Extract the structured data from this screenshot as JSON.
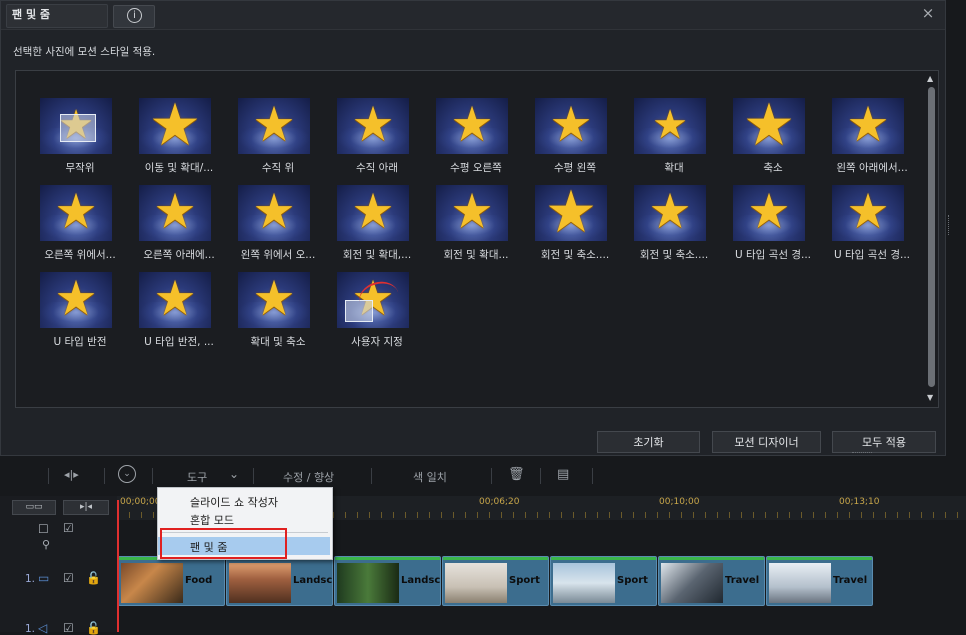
{
  "dialog": {
    "title": "팬 및 줌",
    "close_glyph": "×",
    "info_glyph": "i",
    "instruction": "선택한 사진에 모션 스타일 적용.",
    "styles": [
      "무작위",
      "이동 및 확대/...",
      "수직 위",
      "수직 아래",
      "수평 오른쪽",
      "수평 왼쪽",
      "확대",
      "축소",
      "왼쪽 아래에서...",
      "오른쪽 위에서...",
      "오른쪽 아래에...",
      "왼쪽 위에서 오...",
      "회전 및 확대,...",
      "회전 및 확대...",
      "회전 및 축소....",
      "회전 및 축소....",
      "U 타입 곡선 경...",
      "U 타입 곡선 경...",
      "U 타입 반전",
      "U 타입 반전, ...",
      "확대 및 축소",
      "사용자 지정"
    ],
    "buttons": {
      "reset": "초기화",
      "motion_designer": "모션 디자이너",
      "apply_all": "모두 적용"
    }
  },
  "toolbar": {
    "tools": "도구",
    "edit_enhance": "수정 / 향상",
    "color_match": "색 일치"
  },
  "timeline": {
    "ruler_labels": [
      "00;00;00",
      "00;06;20",
      "00;10;00",
      "00;13;10"
    ],
    "track_video_label": "1.",
    "track_audio_label": "1.",
    "clips": [
      "Food",
      "Landsc",
      "Landsc",
      "Sport",
      "Sport",
      "Travel",
      "Travel"
    ]
  },
  "context_menu": {
    "items": [
      "슬라이드 쇼 작성자",
      "혼합 모드",
      "팬 및 줌"
    ],
    "selected": "팬 및 줌"
  },
  "colors": {
    "accent_red": "#e02020",
    "playhead": "#e03030",
    "clip": "#3c6d8e",
    "star": "#f5c02a"
  }
}
